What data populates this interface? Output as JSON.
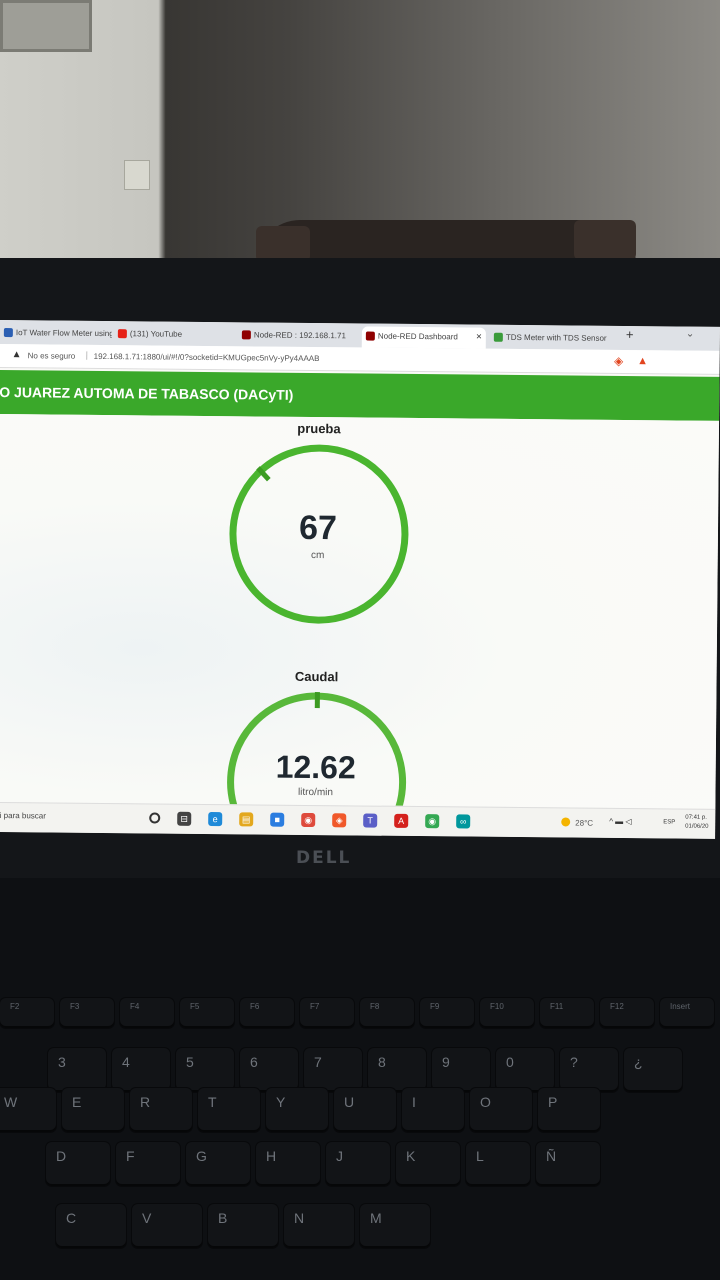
{
  "browser": {
    "tabs": [
      {
        "label": "IoT Water Flow Meter using",
        "favicon_color": "#2b5fb3",
        "active": false
      },
      {
        "label": "(131) YouTube",
        "favicon_color": "#e62117",
        "active": false
      },
      {
        "label": "Node-RED : 192.168.1.71",
        "favicon_color": "#8f0000",
        "active": false
      },
      {
        "label": "Node-RED Dashboard",
        "favicon_color": "#8f0000",
        "active": true
      },
      {
        "label": "TDS Meter with TDS Sensor",
        "favicon_color": "#3a9b3a",
        "active": false
      }
    ],
    "new_tab": "+",
    "close_glyph": "×",
    "chevron": "⌄",
    "address": {
      "warning_glyph": "▲",
      "insecure_label": "No es seguro",
      "separator": "|",
      "url": "192.168.1.71:1880/ui/#!/0?socketid=KMUGpec5nVy-yPy4AAAB"
    },
    "shield_glyph": "◈",
    "triangle_glyph": "▲"
  },
  "dashboard": {
    "banner_title": "O JUAREZ AUTOMA DE TABASCO (DACyTI)",
    "accent": "#3aa82a",
    "gauges": [
      {
        "label": "prueba",
        "value": "67",
        "unit": "cm",
        "level": 0.88,
        "style": "donut",
        "color": "#4ab52f"
      },
      {
        "label": "Caudal",
        "value": "12.62",
        "unit": "litro/min",
        "level": 0.5,
        "style": "arc",
        "color": "#58b83a"
      }
    ]
  },
  "taskbar": {
    "search_text": "ui para buscar",
    "weather": "28°C",
    "tray": "^ ▬ ◁",
    "lang": "ESP",
    "time": "07:41 p.",
    "date": "01/06/20",
    "icons": [
      {
        "name": "task-view-icon",
        "glyph": "⊟",
        "color": "#444"
      },
      {
        "name": "edge-icon",
        "glyph": "e",
        "color": "#1f8ad8"
      },
      {
        "name": "files-icon",
        "glyph": "▤",
        "color": "#e3a81e"
      },
      {
        "name": "store-icon",
        "glyph": "■",
        "color": "#2b7de0"
      },
      {
        "name": "chrome-icon",
        "glyph": "◉",
        "color": "#de4a3c"
      },
      {
        "name": "brave-icon",
        "glyph": "◈",
        "color": "#f0582a"
      },
      {
        "name": "teams-icon",
        "glyph": "T",
        "color": "#5b5fc7"
      },
      {
        "name": "acrobat-icon",
        "glyph": "A",
        "color": "#d4211d"
      },
      {
        "name": "chrome-alt-icon",
        "glyph": "◉",
        "color": "#34a853"
      },
      {
        "name": "arduino-icon",
        "glyph": "∞",
        "color": "#00979c"
      }
    ]
  },
  "laptop": {
    "brand": "DELL"
  },
  "keyboard": {
    "rows": [
      [
        "F2",
        "F3",
        "F4",
        "F5",
        "F6",
        "F7",
        "F8",
        "F9",
        "F10",
        "F11",
        "F12",
        "Insert"
      ],
      [
        "3",
        "4",
        "5",
        "6",
        "7",
        "8",
        "9",
        "0",
        "?",
        "¿"
      ],
      [
        "W",
        "E",
        "R",
        "T",
        "Y",
        "U",
        "I",
        "O",
        "P"
      ],
      [
        "D",
        "F",
        "G",
        "H",
        "J",
        "K",
        "L",
        "Ñ"
      ],
      [
        "C",
        "V",
        "B",
        "N",
        "M"
      ]
    ]
  }
}
